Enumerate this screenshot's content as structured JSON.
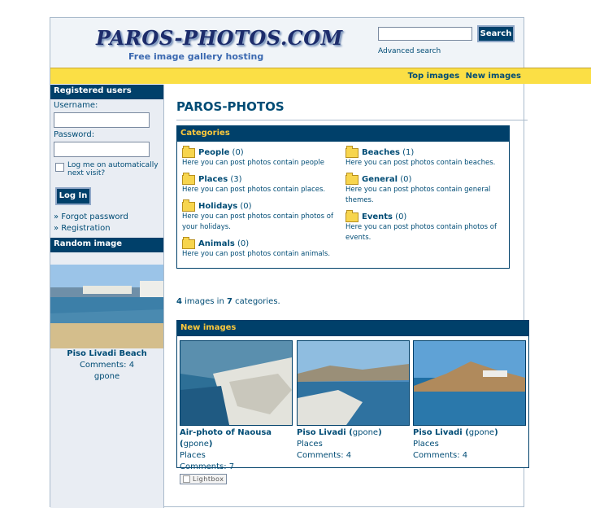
{
  "header": {
    "logo": "PAROS-PHOTOS.COM",
    "tagline": "Free image gallery hosting",
    "search_button": "Search",
    "advanced_search": "Advanced search"
  },
  "toplinks": {
    "top_images": "Top images",
    "new_images": "New images"
  },
  "sidebar": {
    "registered_users": "Registered users",
    "username_label": "Username:",
    "password_label": "Password:",
    "remember": "Log me on automatically next visit?",
    "login": "Log In",
    "forgot": "Forgot password",
    "registration": "Registration",
    "random_image": "Random image",
    "random_caption": "Piso Livadi Beach",
    "random_comments": "Comments: 4",
    "random_user": "gpone"
  },
  "main": {
    "title": "PAROS-PHOTOS",
    "categories_heading": "Categories",
    "categories_left": [
      {
        "name": "People",
        "count": "(0)",
        "desc": "Here you can post photos contain people"
      },
      {
        "name": "Places",
        "count": "(3)",
        "desc": "Here you can post photos contain places."
      },
      {
        "name": "Holidays",
        "count": "(0)",
        "desc": "Here you can post photos contain photos of your holidays."
      },
      {
        "name": "Animals",
        "count": "(0)",
        "desc": "Here you can post photos contain animals."
      }
    ],
    "categories_right": [
      {
        "name": "Beaches",
        "count": "(1)",
        "desc": "Here you can post photos contain beaches."
      },
      {
        "name": "General",
        "count": "(0)",
        "desc": "Here you can post photos contain general themes."
      },
      {
        "name": "Events",
        "count": "(0)",
        "desc": "Here you can post photos contain photos of events."
      }
    ],
    "stats_images": "4",
    "stats_mid": " images in ",
    "stats_categories": "7",
    "stats_end": " categories.",
    "new_images_heading": "New images",
    "new_images": [
      {
        "title": "Air-photo of Naousa",
        "user": "gpone",
        "category": "Places",
        "comments": "Comments: 7",
        "lightbox": "Lightbox"
      },
      {
        "title": "Piso Livadi",
        "user": "gpone",
        "category": "Places",
        "comments": "Comments: 4"
      },
      {
        "title": "Piso Livadi",
        "user": "gpone",
        "category": "Places",
        "comments": "Comments: 4"
      }
    ]
  }
}
